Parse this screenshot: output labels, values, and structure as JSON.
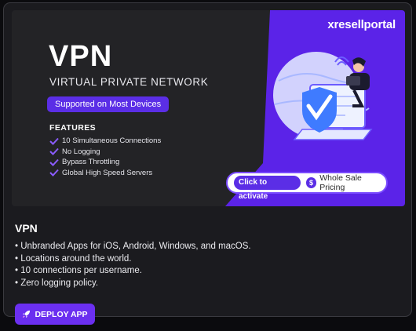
{
  "banner": {
    "brand": "resellportal",
    "brand_mark": "x",
    "title": "VPN",
    "subtitle": "VIRTUAL PRIVATE NETWORK",
    "support_pill": "Supported on Most Devices",
    "features_heading": "FEATURES",
    "features": [
      "10 Simultaneous Connections",
      "No Logging",
      "Bypass Throttling",
      "Global High Speed Servers"
    ],
    "cta_activate": "Click to activate",
    "cta_dollar": "$",
    "cta_pricing": "Whole Sale Pricing"
  },
  "app": {
    "name": "VPN",
    "description": [
      "• Unbranded Apps for iOS, Android, Windows, and macOS.",
      "• Locations around the world.",
      "• 10 connections per username.",
      "• Zero logging policy."
    ],
    "deploy_label": "DEPLOY APP"
  },
  "colors": {
    "accent": "#6b2ff0",
    "banner_purple": "#5b23e8",
    "card_bg": "#1b1b1f",
    "check": "#8b5cff"
  },
  "icons": {
    "feature_check": "check-icon",
    "deploy": "rocket-icon",
    "hero": "vpn-shield-illustration"
  }
}
